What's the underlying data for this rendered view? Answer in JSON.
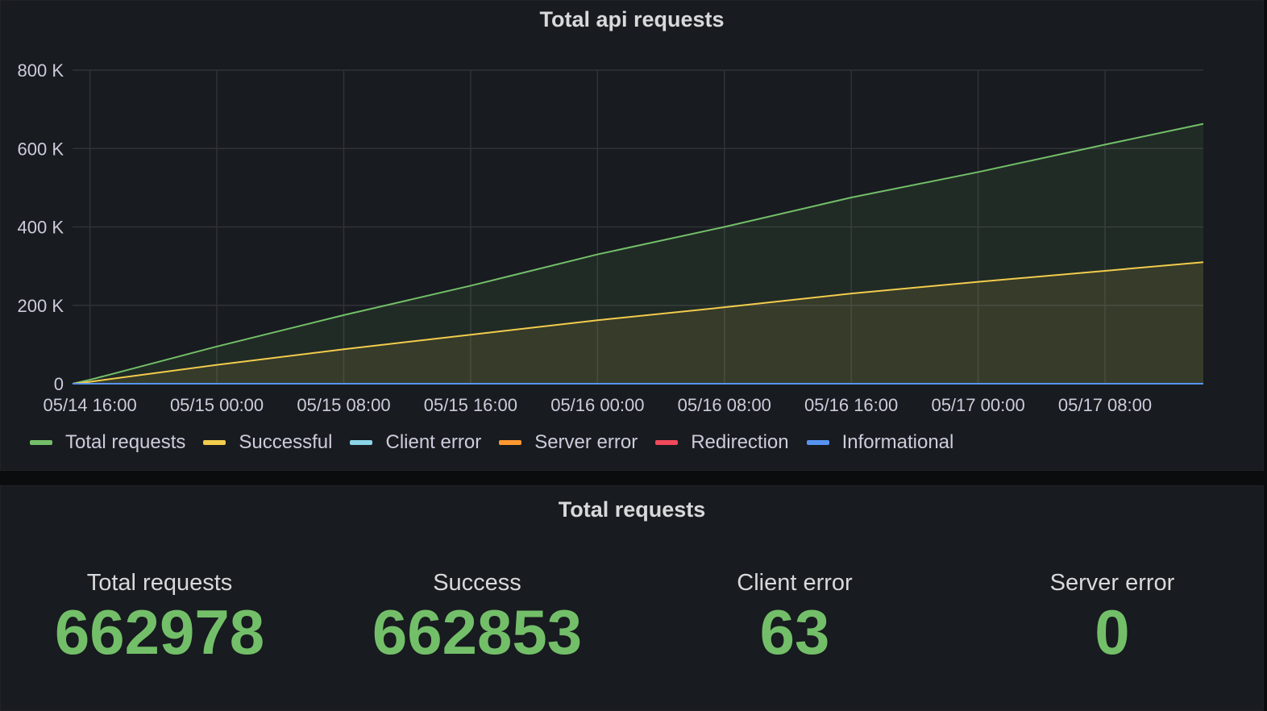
{
  "graph_panel": {
    "title": "Total api requests"
  },
  "chart_data": {
    "type": "area",
    "title": "Total api requests",
    "xlabel": "",
    "ylabel": "",
    "x_tick_labels": [
      "05/14 16:00",
      "05/15 00:00",
      "05/15 08:00",
      "05/15 16:00",
      "05/16 00:00",
      "05/16 08:00",
      "05/16 16:00",
      "05/17 00:00",
      "05/17 08:00"
    ],
    "y_tick_labels": [
      "0",
      "200 K",
      "400 K",
      "600 K",
      "800 K"
    ],
    "y_ticks": [
      0,
      200000,
      400000,
      600000,
      800000
    ],
    "ylim": [
      0,
      800000
    ],
    "xlim_hours": [
      -1.1,
      70.2
    ],
    "x_hours": [
      -1.1,
      0,
      8,
      16,
      24,
      32,
      40,
      48,
      56,
      64,
      70.2
    ],
    "grid": true,
    "legend_position": "bottom-left",
    "series": [
      {
        "name": "Total requests",
        "color": "#73bf69",
        "fill": true,
        "values": [
          0,
          10000,
          95000,
          175000,
          250000,
          330000,
          400000,
          475000,
          540000,
          610000,
          663000
        ]
      },
      {
        "name": "Successful",
        "color": "#f2cc4c",
        "fill": true,
        "values": [
          0,
          5000,
          48000,
          88000,
          125000,
          162000,
          195000,
          230000,
          260000,
          288000,
          310000
        ]
      },
      {
        "name": "Client error",
        "color": "#8ad5e6",
        "fill": false,
        "values": [
          0,
          0,
          0,
          0,
          0,
          0,
          0,
          0,
          0,
          0,
          0
        ]
      },
      {
        "name": "Server error",
        "color": "#ff9830",
        "fill": false,
        "values": [
          0,
          0,
          0,
          0,
          0,
          0,
          0,
          0,
          0,
          0,
          0
        ]
      },
      {
        "name": "Redirection",
        "color": "#f2495c",
        "fill": false,
        "values": [
          0,
          0,
          0,
          0,
          0,
          0,
          0,
          0,
          0,
          0,
          0
        ]
      },
      {
        "name": "Informational",
        "color": "#5794f2",
        "fill": false,
        "values": [
          0,
          0,
          0,
          0,
          0,
          0,
          0,
          0,
          0,
          0,
          0
        ]
      }
    ]
  },
  "legend": [
    {
      "label": "Total requests",
      "color": "#73bf69"
    },
    {
      "label": "Successful",
      "color": "#f2cc4c"
    },
    {
      "label": "Client error",
      "color": "#8ad5e6"
    },
    {
      "label": "Server error",
      "color": "#ff9830"
    },
    {
      "label": "Redirection",
      "color": "#f2495c"
    },
    {
      "label": "Informational",
      "color": "#5794f2"
    }
  ],
  "stats_panel": {
    "title": "Total requests",
    "value_color": "#73bf69",
    "stats": [
      {
        "label": "Total requests",
        "value": "662978"
      },
      {
        "label": "Success",
        "value": "662853"
      },
      {
        "label": "Client error",
        "value": "63"
      },
      {
        "label": "Server error",
        "value": "0"
      }
    ]
  }
}
